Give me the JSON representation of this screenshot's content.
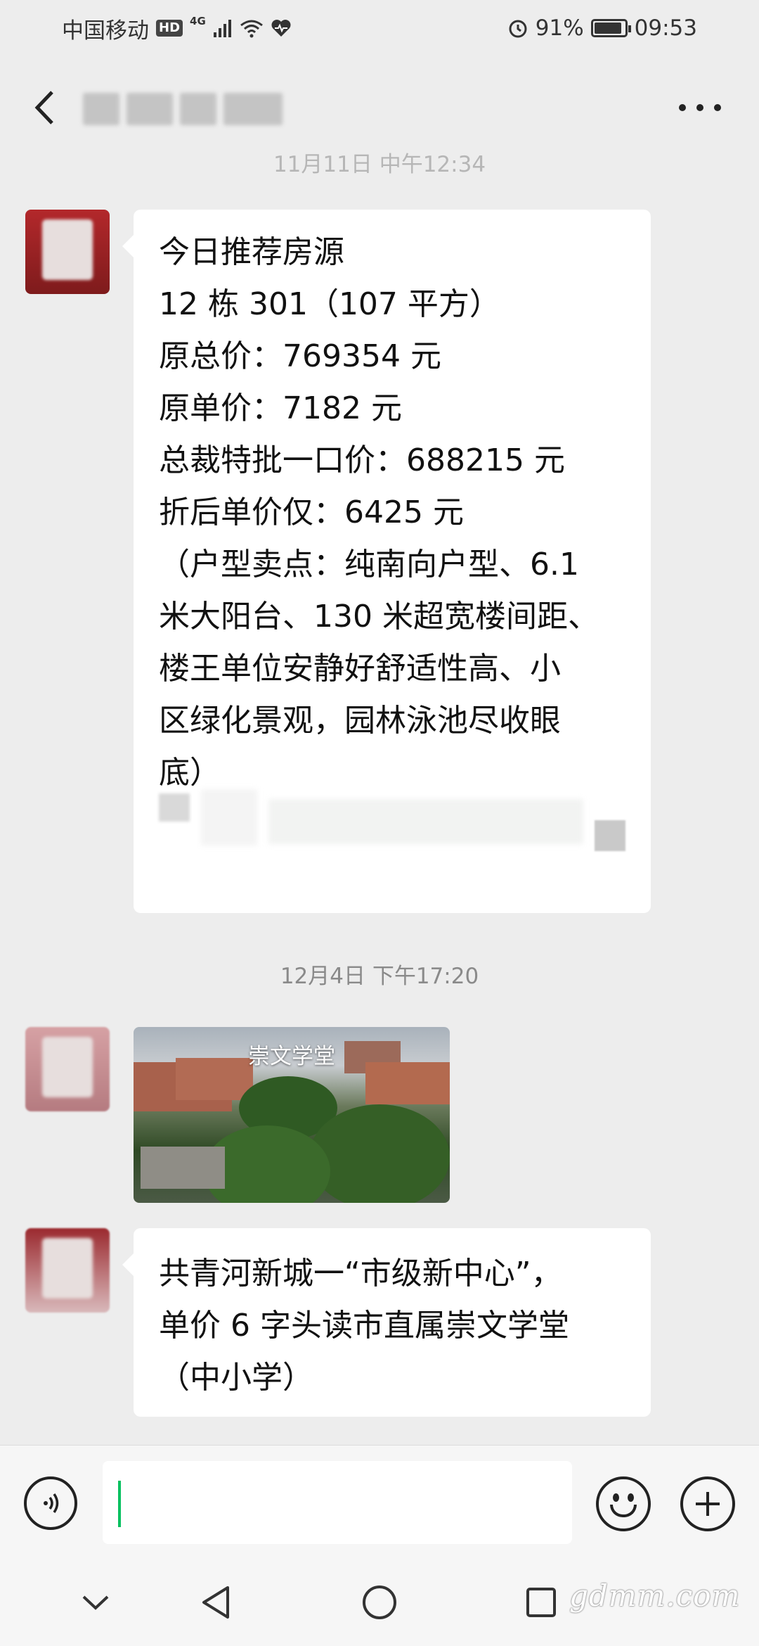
{
  "status_bar": {
    "carrier": "中国移动",
    "hd": "HD",
    "network": "4G",
    "battery": "91%",
    "battery_level": 0.91,
    "time": "09:53"
  },
  "nav": {
    "back_icon": "chevron-left-icon",
    "more_icon": "more-dots-icon"
  },
  "messages": {
    "timestamp_1": "11月11日 中午12:34",
    "bubble_1": {
      "lines": [
        "今日推荐房源",
        "12 栋 301（107 平方）",
        "原总价：769354 元",
        "原单价：7182 元",
        "总裁特批一口价：688215 元",
        "折后单价仅：6425 元",
        "（户型卖点：纯南向户型、6.1",
        "米大阳台、130 米超宽楼间距、",
        "楼王单位安静好舒适性高、小",
        "区绿化景观，园林泳池尽收眼",
        "底）"
      ]
    },
    "timestamp_2": "12月4日 下午17:20",
    "photo_caption": "崇文学堂",
    "bubble_3": {
      "lines": [
        "共青河新城一“市级新中心”，",
        "单价 6 字头读市直属崇文学堂",
        "（中小学）"
      ]
    }
  },
  "input_bar": {
    "voice_icon": "voice-icon",
    "text_value": "",
    "emoji_icon": "emoji-icon",
    "plus_icon": "plus-icon"
  },
  "system_nav": {
    "watermark": "gdmm.com"
  },
  "colors": {
    "background": "#ededed",
    "bubble": "#ffffff",
    "caret": "#07c160",
    "timestamp": "#8a8a8a"
  }
}
